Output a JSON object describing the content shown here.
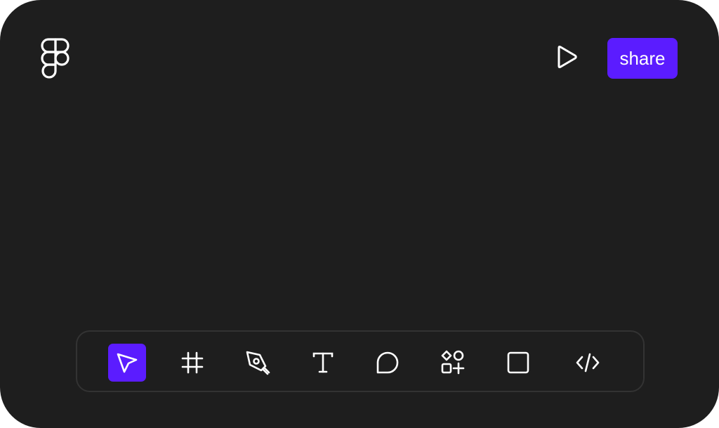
{
  "header": {
    "logo_icon": "figma-logo-icon",
    "play_icon": "play-icon",
    "share_label": "share"
  },
  "colors": {
    "background": "#1e1e1e",
    "accent": "#5b1cff",
    "toolbar_border": "#333333",
    "icon": "#ffffff"
  },
  "toolbar": {
    "active_tool": "move",
    "tools": [
      {
        "id": "move",
        "icon": "cursor-arrow-icon",
        "active": true
      },
      {
        "id": "frame",
        "icon": "frame-hash-icon",
        "active": false
      },
      {
        "id": "pen",
        "icon": "pen-nib-icon",
        "active": false
      },
      {
        "id": "text",
        "icon": "text-t-icon",
        "active": false
      },
      {
        "id": "comment",
        "icon": "comment-bubble-icon",
        "active": false
      },
      {
        "id": "assets",
        "icon": "shapes-plus-icon",
        "active": false
      },
      {
        "id": "rectangle",
        "icon": "rectangle-icon",
        "active": false
      },
      {
        "id": "code",
        "icon": "code-brackets-icon",
        "active": false
      }
    ]
  }
}
